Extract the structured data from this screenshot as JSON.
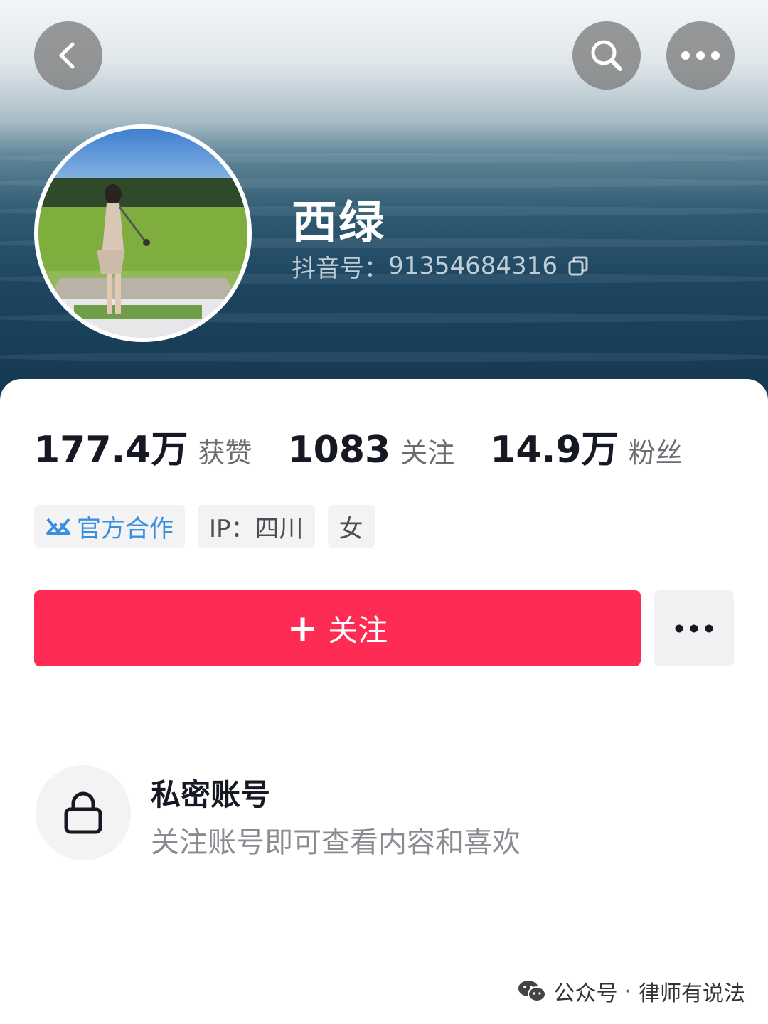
{
  "profile": {
    "nickname": "西绿",
    "douyin_id_label": "抖音号：",
    "douyin_id": "91354684316"
  },
  "stats": [
    {
      "value": "177.4万",
      "label": "获赞"
    },
    {
      "value": "1083",
      "label": "关注"
    },
    {
      "value": "14.9万",
      "label": "粉丝"
    }
  ],
  "tags": {
    "official": "官方合作",
    "ip": "IP：四川",
    "gender": "女"
  },
  "actions": {
    "follow_plus": "+",
    "follow_label": "关注"
  },
  "private_notice": {
    "title": "私密账号",
    "description": "关注账号即可查看内容和喜欢"
  },
  "watermark": {
    "prefix": "公众号",
    "separator": "·",
    "name": "律师有说法"
  },
  "icons": {
    "back": "back-arrow-icon",
    "search": "search-icon",
    "more": "more-dots-icon",
    "copy": "copy-icon",
    "official": "official-cooperation-icon",
    "lock": "lock-icon",
    "wechat": "wechat-icon"
  },
  "colors": {
    "follow_button": "#fe2c55",
    "official_tag_text": "#3a8fe0",
    "header_sea": "#173b55"
  }
}
